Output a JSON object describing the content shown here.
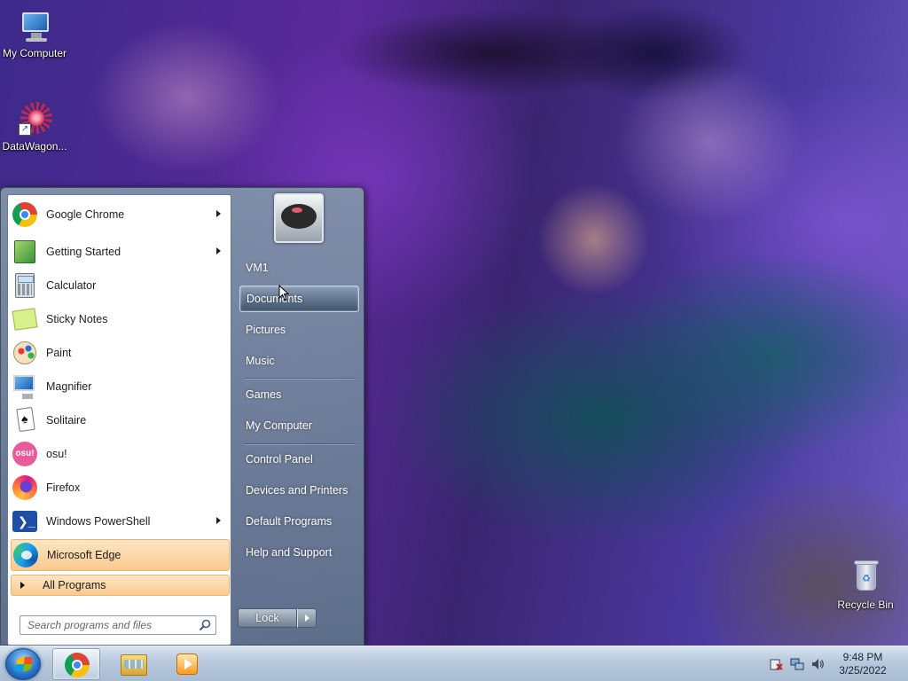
{
  "desktop": {
    "icons": [
      {
        "label": "My Computer",
        "icon": "my-computer-icon"
      },
      {
        "label": "DataWagon...",
        "icon": "datawagon-icon"
      },
      {
        "label": "Recycle Bin",
        "icon": "recycle-bin-icon"
      }
    ]
  },
  "start_menu": {
    "programs": [
      {
        "label": "Google Chrome",
        "icon": "chrome-icon",
        "has_submenu": true
      },
      {
        "label": "Getting Started",
        "icon": "getting-started-icon",
        "has_submenu": true
      },
      {
        "label": "Calculator",
        "icon": "calculator-icon",
        "has_submenu": false
      },
      {
        "label": "Sticky Notes",
        "icon": "sticky-notes-icon",
        "has_submenu": false
      },
      {
        "label": "Paint",
        "icon": "paint-icon",
        "has_submenu": false
      },
      {
        "label": "Magnifier",
        "icon": "magnifier-icon",
        "has_submenu": false
      },
      {
        "label": "Solitaire",
        "icon": "solitaire-icon",
        "has_submenu": false
      },
      {
        "label": "osu!",
        "icon": "osu-icon",
        "icon_text": "osu!",
        "has_submenu": false
      },
      {
        "label": "Firefox",
        "icon": "firefox-icon",
        "has_submenu": false
      },
      {
        "label": "Windows PowerShell",
        "icon": "powershell-icon",
        "icon_text": "❯_",
        "has_submenu": true
      },
      {
        "label": "Microsoft Edge",
        "icon": "edge-icon",
        "has_submenu": false,
        "highlighted": true
      }
    ],
    "all_programs_label": "All Programs",
    "search": {
      "placeholder": "Search programs and files"
    },
    "user_picture": "user-avatar",
    "right_items": [
      {
        "label": "VM1"
      },
      {
        "label": "Documents",
        "selected": true
      },
      {
        "label": "Pictures"
      },
      {
        "label": "Music"
      },
      {
        "label": "Games"
      },
      {
        "label": "My Computer"
      },
      {
        "label": "Control Panel"
      },
      {
        "label": "Devices and Printers"
      },
      {
        "label": "Default Programs"
      },
      {
        "label": "Help and Support"
      }
    ],
    "lock_label": "Lock"
  },
  "taskbar": {
    "start_button": "windows-orb-icon",
    "pinned": [
      {
        "name": "chrome",
        "icon": "chrome-icon",
        "active": true
      },
      {
        "name": "explorer",
        "icon": "folder-icon",
        "active": false
      },
      {
        "name": "media-player",
        "icon": "media-player-icon",
        "active": false
      }
    ],
    "tray": [
      "action-center-icon",
      "network-icon",
      "volume-icon"
    ],
    "clock": {
      "time": "9:48 PM",
      "date": "3/25/2022"
    }
  },
  "colors": {
    "highlight_orange": "#f9c98e",
    "taskbar_blue": "#b8c9dc",
    "start_menu_glass": "#7f93a8"
  }
}
